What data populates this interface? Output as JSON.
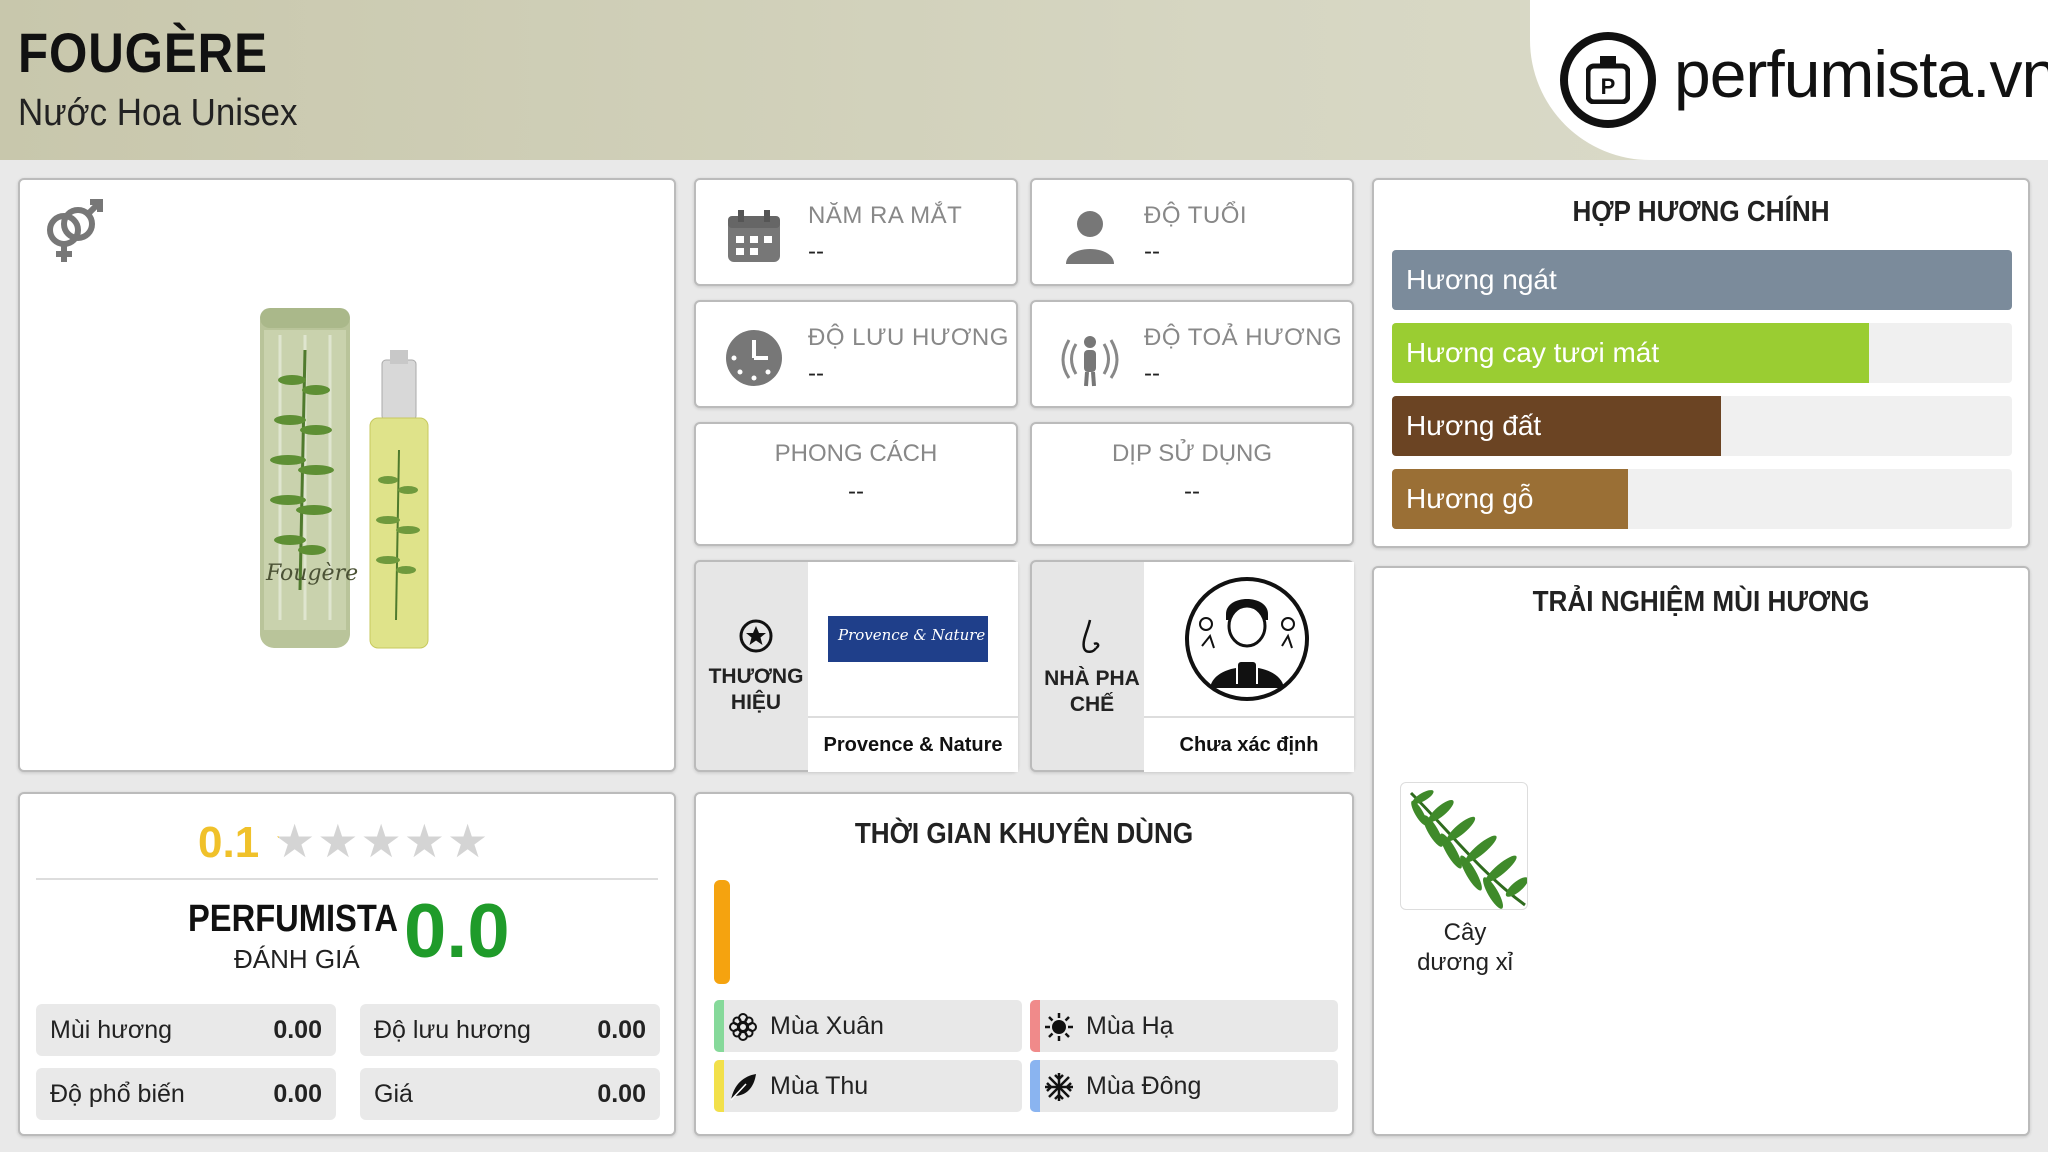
{
  "header": {
    "title": "FOUGÈRE",
    "subtitle": "Nước Hoa Unisex",
    "logo_text": "perfumista.vn"
  },
  "product": {
    "gender_icon": "unisex-gender-icon",
    "bottle_label": "Fougère"
  },
  "info": {
    "release_year": {
      "label": "NĂM RA MẮT",
      "value": "--",
      "icon": "calendar-icon"
    },
    "age": {
      "label": "ĐỘ TUỔI",
      "value": "--",
      "icon": "person-icon"
    },
    "longevity": {
      "label": "ĐỘ LƯU HƯƠNG",
      "value": "--",
      "icon": "clock-icon"
    },
    "sillage": {
      "label": "ĐỘ TOẢ HƯƠNG",
      "value": "--",
      "icon": "sillage-icon"
    },
    "style": {
      "label": "PHONG CÁCH",
      "value": "--"
    },
    "occasion": {
      "label": "DỊP SỬ DỤNG",
      "value": "--"
    }
  },
  "brand": {
    "label": "THƯƠNG HIỆU",
    "name": "Provence & Nature",
    "logo_text": "Provence & Nature",
    "icon": "star-circle-icon"
  },
  "perfumer": {
    "label": "NHÀ PHA CHẾ",
    "name": "Chưa xác định",
    "icon": "nose-icon"
  },
  "accords": {
    "title": "HỢP HƯƠNG CHÍNH",
    "items": [
      {
        "label": "Hương ngát",
        "fraction": 1.0,
        "color": "#7b8b9b"
      },
      {
        "label": "Hương cay tươi mát",
        "fraction": 0.77,
        "color": "#9acd32"
      },
      {
        "label": "Hương đất",
        "fraction": 0.53,
        "color": "#6b4423"
      },
      {
        "label": "Hương gỗ",
        "fraction": 0.38,
        "color": "#9a6f35"
      }
    ]
  },
  "notes": {
    "title": "TRẢI NGHIỆM MÙI HƯƠNG",
    "items": [
      {
        "label": "Cây dương xỉ",
        "icon": "fern-icon"
      }
    ]
  },
  "rating": {
    "user_score": "0.1",
    "stars": 0.02,
    "perfumista_label": "PERFUMISTA",
    "perfumista_sub": "ĐÁNH GIÁ",
    "perfumista_score": "0.0",
    "stats": [
      {
        "label": "Mùi hương",
        "value": "0.00"
      },
      {
        "label": "Độ lưu hương",
        "value": "0.00"
      },
      {
        "label": "Độ phổ biến",
        "value": "0.00"
      },
      {
        "label": "Giá",
        "value": "0.00"
      }
    ]
  },
  "seasons": {
    "title": "THỜI GIAN KHUYÊN DÙNG",
    "day_bar_color": "#f5a30f",
    "items": [
      {
        "label": "Mùa Xuân",
        "color": "#86d99a",
        "icon": "flower-icon"
      },
      {
        "label": "Mùa Hạ",
        "color": "#f08a8a",
        "icon": "sun-icon"
      },
      {
        "label": "Mùa Thu",
        "color": "#f2e04a",
        "icon": "leaf-icon"
      },
      {
        "label": "Mùa Đông",
        "color": "#8ab4f0",
        "icon": "snowflake-icon"
      }
    ]
  }
}
